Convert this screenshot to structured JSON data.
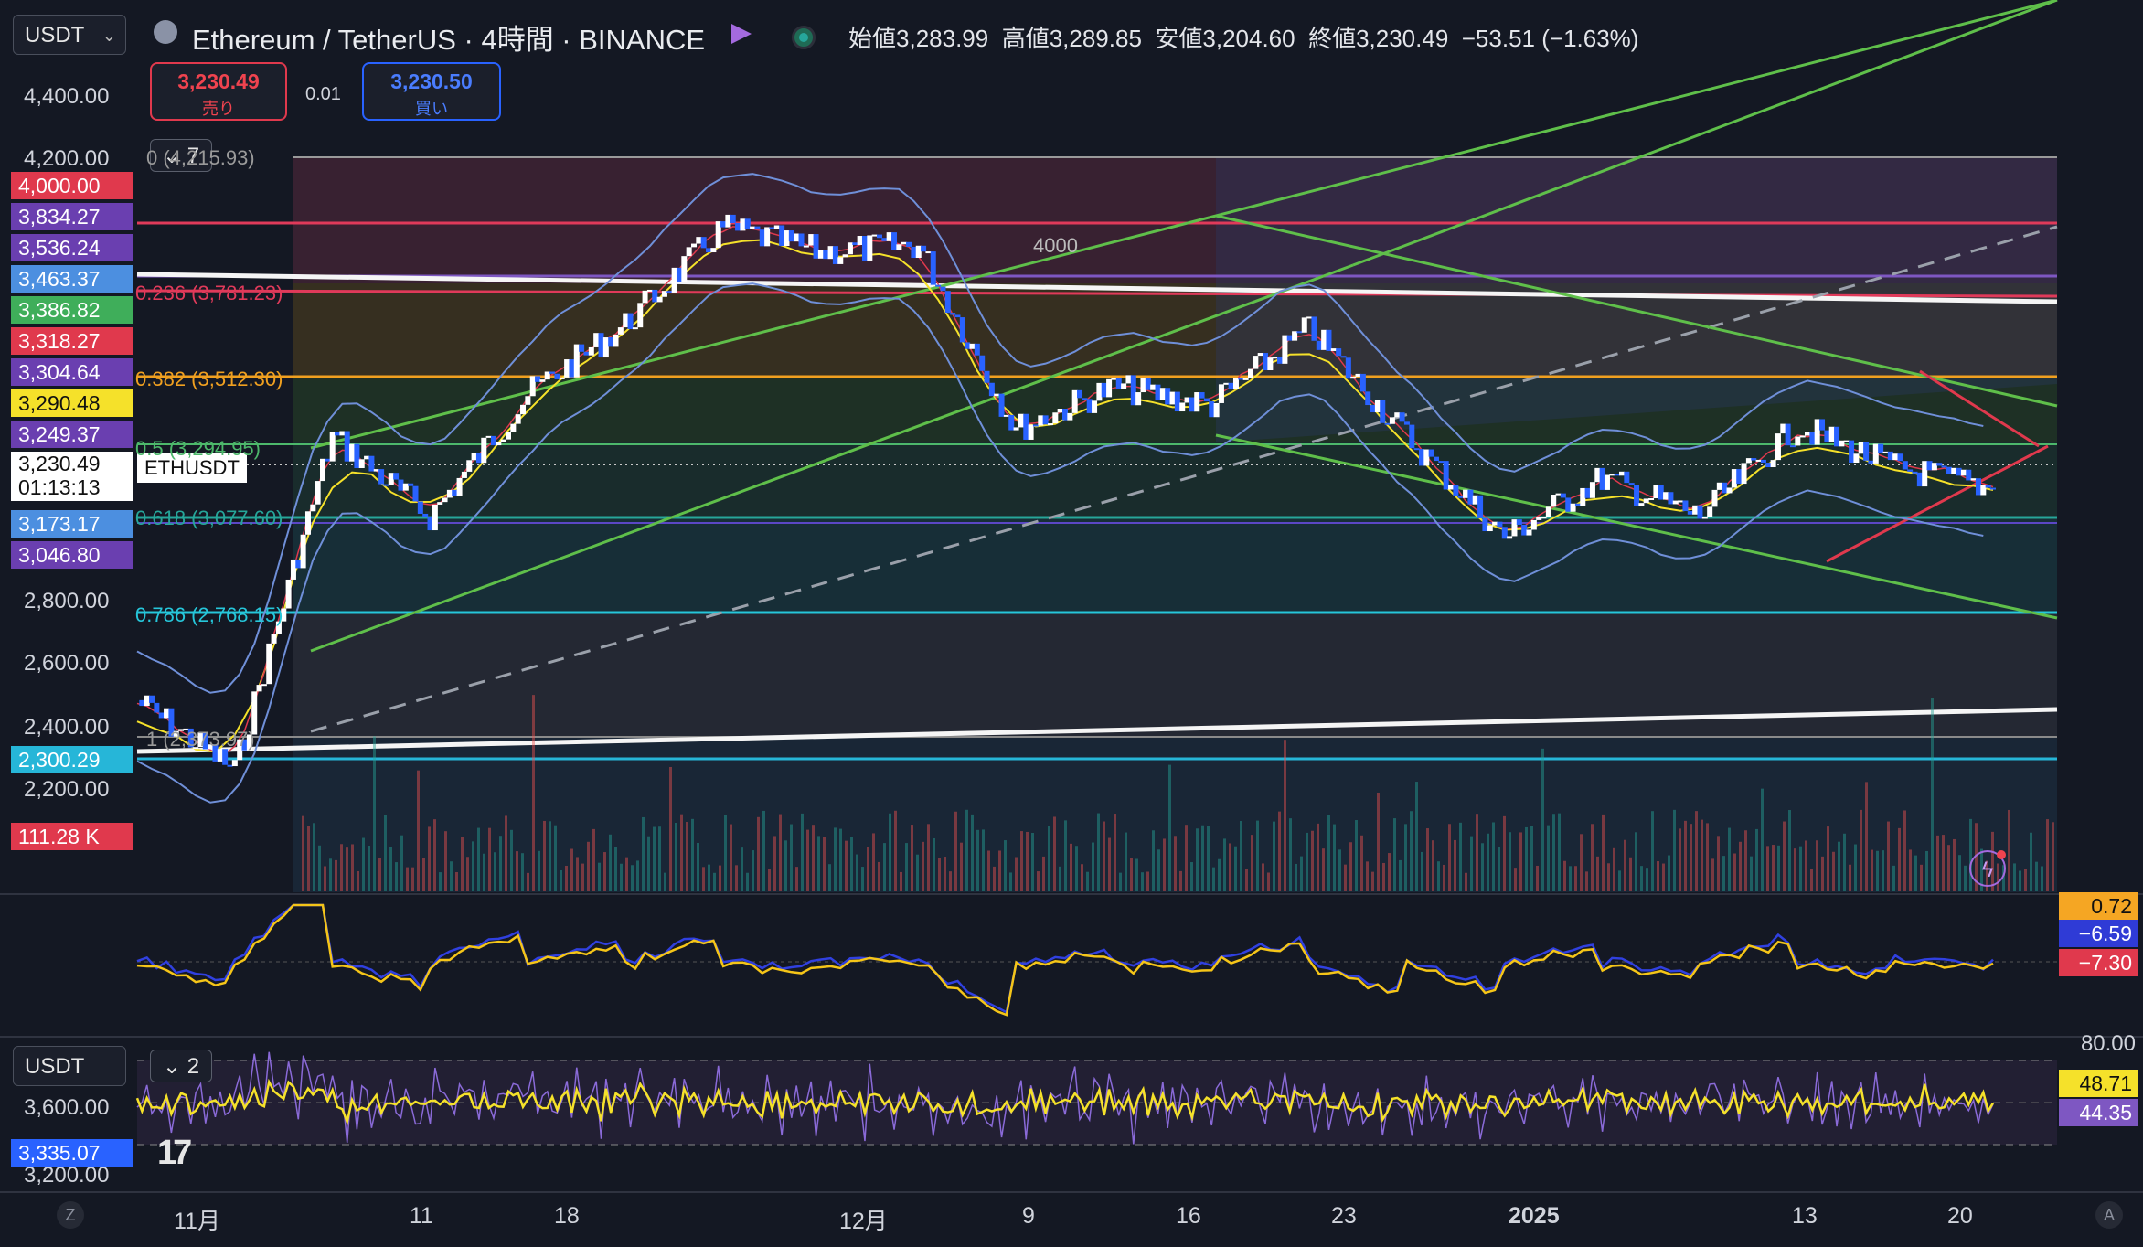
{
  "header": {
    "symbol_select": "USDT",
    "title": "Ethereum / TetherUS · 4時間 · BINANCE",
    "ohlc": {
      "open_label": "始値",
      "open": "3,283.99",
      "high_label": "高値",
      "high": "3,289.85",
      "low_label": "安値",
      "low": "3,204.60",
      "close_label": "終値",
      "close": "3,230.49",
      "change": "−53.51 (−1.63%)"
    }
  },
  "trade": {
    "sell_price": "3,230.49",
    "sell_label": "売り",
    "spread": "0.01",
    "buy_price": "3,230.50",
    "buy_label": "買い"
  },
  "pane_collapse": {
    "main": "7",
    "lower": "2"
  },
  "price_axis": {
    "ticks": [
      "4,400.00",
      "4,200.00",
      "2,800.00",
      "2,600.00",
      "2,400.00",
      "2,200.00"
    ],
    "tags": [
      {
        "text": "4,000.00",
        "color": "#e0394d"
      },
      {
        "text": "3,834.27",
        "color": "#6a3fb0"
      },
      {
        "text": "3,536.24",
        "color": "#6a3fb0"
      },
      {
        "text": "3,463.37",
        "color": "#4c8fe0"
      },
      {
        "text": "3,386.82",
        "color": "#3fae5a"
      },
      {
        "text": "3,318.27",
        "color": "#e0394d"
      },
      {
        "text": "3,304.64",
        "color": "#6a3fb0"
      },
      {
        "text": "3,290.48",
        "color": "#f5e12a"
      },
      {
        "text": "3,249.37",
        "color": "#6a3fb0"
      },
      {
        "text": "3,173.17",
        "color": "#4c8fe0"
      },
      {
        "text": "3,046.80",
        "color": "#6a3fb0"
      },
      {
        "text": "2,300.29",
        "color": "#26b6d8"
      },
      {
        "text": "111.28 K",
        "color": "#e0394d"
      }
    ],
    "current_price": "3,230.49",
    "countdown": "01:13:13",
    "symbol_tag": "ETHUSDT"
  },
  "fib_labels": [
    {
      "text": "0 (4,215.93)"
    },
    {
      "text": "0.236 (3,781.23)"
    },
    {
      "text": "0.382 (3,512.30)"
    },
    {
      "text": "0.5 (3,294.95)"
    },
    {
      "text": "0.618 (3,077.60)"
    },
    {
      "text": "0.786 (2,768.15)"
    },
    {
      "text": "1 (2,373.97)"
    }
  ],
  "annotation_4000": "4000",
  "macd_pane": {
    "values": [
      "0.72",
      "−6.59",
      "−7.30"
    ]
  },
  "lower_pane": {
    "select": "USDT",
    "left_ticks": [
      "3,600.00",
      "3,200.00"
    ],
    "left_tag": "3,335.07",
    "right_ticks": [
      "80.00"
    ],
    "right_tags": [
      "48.71",
      "44.35"
    ]
  },
  "x_axis": {
    "labels": [
      "11月",
      "11",
      "18",
      "12月",
      "9",
      "16",
      "23",
      "2025",
      "13",
      "20"
    ],
    "corner_left": "Z",
    "corner_right": "A"
  },
  "chart_data": {
    "type": "line",
    "title": "Ethereum / TetherUS · 4時間 · BINANCE",
    "xlabel": "",
    "ylabel": "",
    "ylim": [
      2150,
      4450
    ],
    "x": [
      "11月",
      "11",
      "18",
      "12月",
      "9",
      "16",
      "23",
      "2025",
      "13",
      "20"
    ],
    "series": [
      {
        "values": [
          2620,
          2420,
          3380,
          3150,
          3500,
          3700,
          3980,
          3910,
          3930,
          3400,
          3520,
          3470,
          3690,
          3380,
          3090,
          3260,
          3150,
          3410,
          3290,
          3230
        ]
      }
    ],
    "reference_levels": [
      4000.0,
      3834.27,
      3536.24,
      3463.37,
      3386.82,
      3318.27,
      3304.64,
      3290.48,
      3249.37,
      3173.17,
      3046.8,
      2300.29
    ],
    "fib": [
      4215.93,
      3781.23,
      3512.3,
      3294.95,
      3077.6,
      2768.15,
      2373.97
    ],
    "grid": false,
    "legend": "none"
  }
}
